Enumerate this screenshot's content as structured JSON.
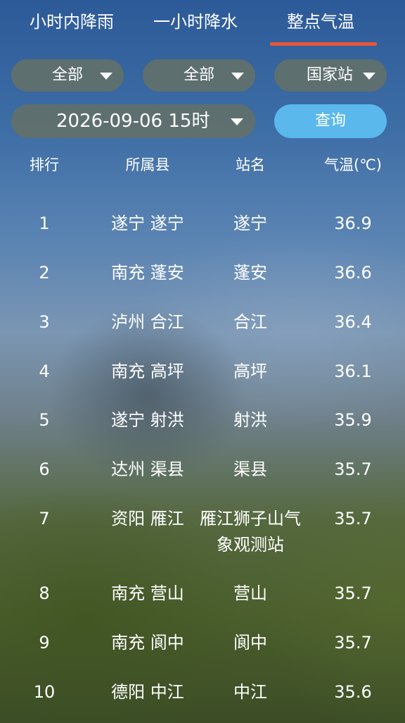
{
  "tabs": [
    {
      "label": "小时内降雨"
    },
    {
      "label": "一小时降水"
    },
    {
      "label": "整点气温"
    }
  ],
  "active_tab_color": "#e8563a",
  "filters": {
    "region_label": "全部",
    "county_label": "全部",
    "station_type_label": "国家站",
    "datetime_label": "2026-09-06 15时",
    "query_label": "查询",
    "query_button_color": "#5ab8ec"
  },
  "table": {
    "headers": {
      "rank": "排行",
      "county": "所属县",
      "station": "站名",
      "temp": "气温(℃)"
    },
    "rows": [
      {
        "rank": "1",
        "county": "遂宁 遂宁",
        "station": "遂宁",
        "temp": "36.9"
      },
      {
        "rank": "2",
        "county": "南充 蓬安",
        "station": "蓬安",
        "temp": "36.6"
      },
      {
        "rank": "3",
        "county": "泸州 合江",
        "station": "合江",
        "temp": "36.4"
      },
      {
        "rank": "4",
        "county": "南充 高坪",
        "station": "高坪",
        "temp": "36.1"
      },
      {
        "rank": "5",
        "county": "遂宁 射洪",
        "station": "射洪",
        "temp": "35.9"
      },
      {
        "rank": "6",
        "county": "达州 渠县",
        "station": "渠县",
        "temp": "35.7"
      },
      {
        "rank": "7",
        "county": "资阳 雁江",
        "station": "雁江狮子山气象观测站",
        "temp": "35.7"
      },
      {
        "rank": "8",
        "county": "南充 营山",
        "station": "营山",
        "temp": "35.7"
      },
      {
        "rank": "9",
        "county": "南充 阆中",
        "station": "阆中",
        "temp": "35.7"
      },
      {
        "rank": "10",
        "county": "德阳 中江",
        "station": "中江",
        "temp": "35.6"
      }
    ]
  }
}
